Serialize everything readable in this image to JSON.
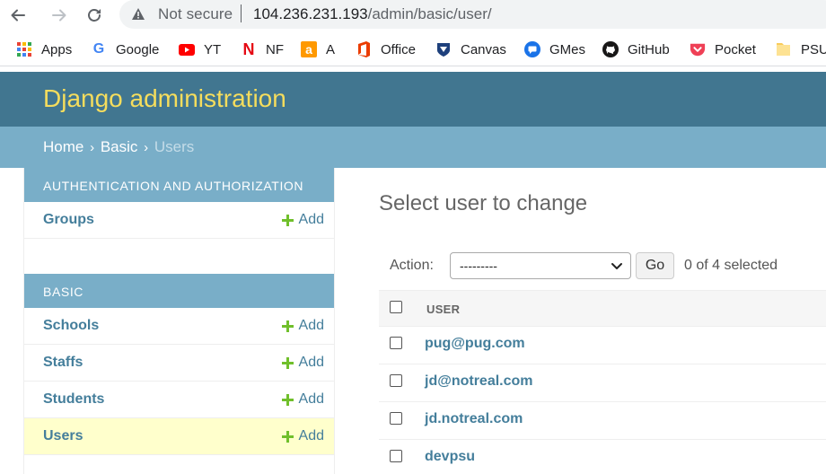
{
  "browser": {
    "security_label": "Not secure",
    "url_host": "104.236.231.193",
    "url_path": "/admin/basic/user/",
    "bookmarks": [
      {
        "label": "Apps",
        "icon": "apps-grid-icon"
      },
      {
        "label": "Google",
        "icon": "google-icon"
      },
      {
        "label": "YT",
        "icon": "youtube-icon"
      },
      {
        "label": "NF",
        "icon": "netflix-icon"
      },
      {
        "label": "A",
        "icon": "amazon-icon"
      },
      {
        "label": "Office",
        "icon": "office-icon"
      },
      {
        "label": "Canvas",
        "icon": "canvas-icon"
      },
      {
        "label": "GMes",
        "icon": "messages-icon"
      },
      {
        "label": "GitHub",
        "icon": "github-icon"
      },
      {
        "label": "Pocket",
        "icon": "pocket-icon"
      },
      {
        "label": "PSU",
        "icon": "folder-icon"
      }
    ]
  },
  "header": {
    "brand": "Django administration"
  },
  "breadcrumbs": {
    "home": "Home",
    "app": "Basic",
    "current": "Users",
    "separator": "›"
  },
  "sidebar": {
    "modules": [
      {
        "caption": "AUTHENTICATION AND AUTHORIZATION",
        "models": [
          {
            "name": "Groups",
            "add": "Add"
          }
        ]
      },
      {
        "caption": "BASIC",
        "models": [
          {
            "name": "Schools",
            "add": "Add"
          },
          {
            "name": "Staffs",
            "add": "Add"
          },
          {
            "name": "Students",
            "add": "Add"
          },
          {
            "name": "Users",
            "add": "Add"
          }
        ]
      }
    ]
  },
  "content": {
    "title": "Select user to change",
    "action_label": "Action:",
    "action_selected": "---------",
    "go_label": "Go",
    "selection_count": "0 of 4 selected",
    "column_header": "USER",
    "rows": [
      "pug@pug.com",
      "jd@notreal.com",
      "jd.notreal.com",
      "devpsu"
    ]
  },
  "colors": {
    "header_bg": "#417690",
    "brand_text": "#f5dd5d",
    "breadcrumb_bg": "#79aec8",
    "link": "#447e9b",
    "add_plus": "#70bf2b",
    "active_row": "#ffffcc"
  }
}
